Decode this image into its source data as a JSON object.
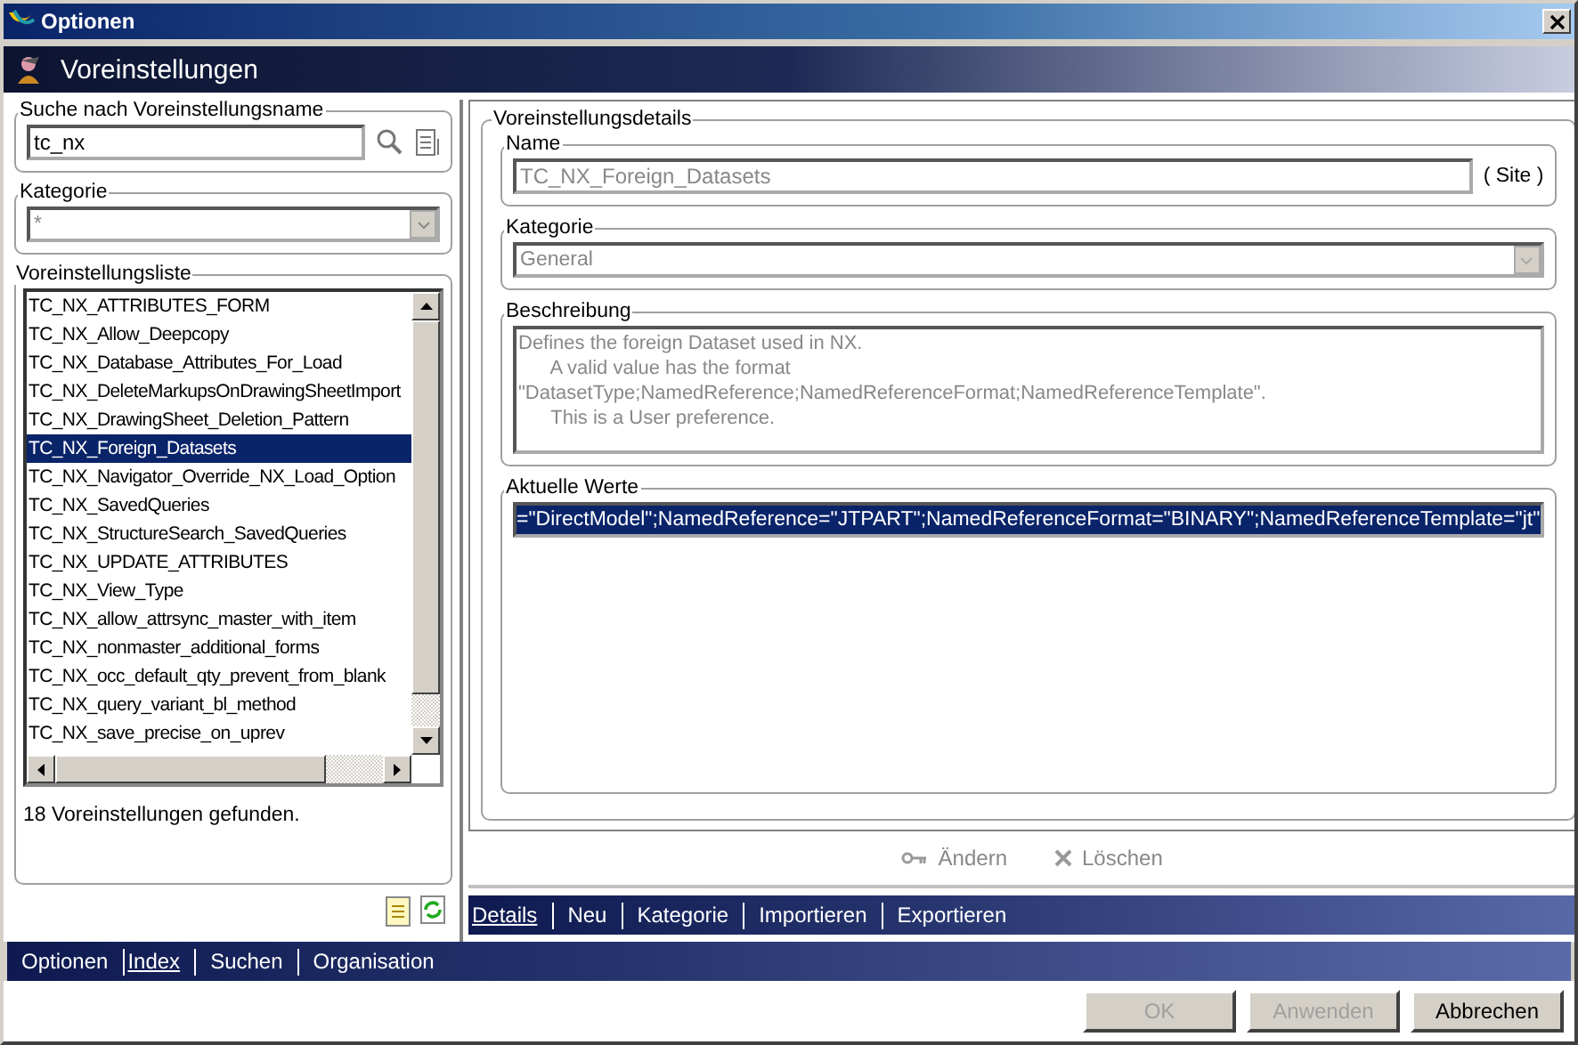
{
  "window": {
    "title": "Optionen"
  },
  "header": {
    "title": "Voreinstellungen"
  },
  "search": {
    "legend": "Suche nach Voreinstellungsname",
    "value": "tc_nx"
  },
  "category_filter": {
    "legend": "Kategorie",
    "value": "*"
  },
  "preference_list": {
    "legend": "Voreinstellungsliste",
    "items": [
      {
        "label": "TC_NX_ATTRIBUTES_FORM",
        "selected": false
      },
      {
        "label": "TC_NX_Allow_Deepcopy",
        "selected": false
      },
      {
        "label": "TC_NX_Database_Attributes_For_Load",
        "selected": false
      },
      {
        "label": "TC_NX_DeleteMarkupsOnDrawingSheetImport",
        "selected": false
      },
      {
        "label": "TC_NX_DrawingSheet_Deletion_Pattern",
        "selected": false
      },
      {
        "label": "TC_NX_Foreign_Datasets",
        "selected": true
      },
      {
        "label": "TC_NX_Navigator_Override_NX_Load_Option",
        "selected": false
      },
      {
        "label": "TC_NX_SavedQueries",
        "selected": false
      },
      {
        "label": "TC_NX_StructureSearch_SavedQueries",
        "selected": false
      },
      {
        "label": "TC_NX_UPDATE_ATTRIBUTES",
        "selected": false
      },
      {
        "label": "TC_NX_View_Type",
        "selected": false
      },
      {
        "label": "TC_NX_allow_attrsync_master_with_item",
        "selected": false
      },
      {
        "label": "TC_NX_nonmaster_additional_forms",
        "selected": false
      },
      {
        "label": "TC_NX_occ_default_qty_prevent_from_blank",
        "selected": false
      },
      {
        "label": "TC_NX_query_variant_bl_method",
        "selected": false
      },
      {
        "label": "TC_NX_save_precise_on_uprev",
        "selected": false
      }
    ],
    "count": "18 Voreinstellungen gefunden."
  },
  "details": {
    "legend": "Voreinstellungsdetails",
    "name": {
      "legend": "Name",
      "value": "TC_NX_Foreign_Datasets",
      "scope": "( Site )",
      "disabled": true
    },
    "category": {
      "legend": "Kategorie",
      "value": "General"
    },
    "description": {
      "legend": "Beschreibung",
      "lines": [
        "Defines the foreign Dataset used in NX.",
        "      A valid value has the format",
        "\"DatasetType;NamedReference;NamedReferenceFormat;NamedReferenceTemplate\".",
        "      This is a User preference."
      ]
    },
    "current_values": {
      "legend": "Aktuelle Werte",
      "values": [
        {
          "text": "=\"DirectModel\";NamedReference=\"JTPART\";NamedReferenceFormat=\"BINARY\";NamedReferenceTemplate=\"jt\"",
          "selected": true
        }
      ]
    },
    "actions": [
      {
        "label": "Ändern",
        "kind": "key",
        "disabled": true
      },
      {
        "label": "Löschen",
        "kind": "delete",
        "disabled": true
      }
    ]
  },
  "detail_tabs": [
    {
      "label": "Details",
      "selected": true
    },
    {
      "label": "Neu",
      "selected": false
    },
    {
      "label": "Kategorie",
      "selected": false
    },
    {
      "label": "Importieren",
      "selected": false
    },
    {
      "label": "Exportieren",
      "selected": false
    }
  ],
  "main_tabs": [
    {
      "label": "Optionen",
      "selected": false
    },
    {
      "label": "Index",
      "selected": true
    },
    {
      "label": "Suchen",
      "selected": false
    },
    {
      "label": "Organisation",
      "selected": false
    }
  ],
  "buttons": [
    {
      "label": "OK",
      "disabled": true
    },
    {
      "label": "Anwenden",
      "disabled": true
    },
    {
      "label": "Abbrechen",
      "disabled": false
    }
  ]
}
